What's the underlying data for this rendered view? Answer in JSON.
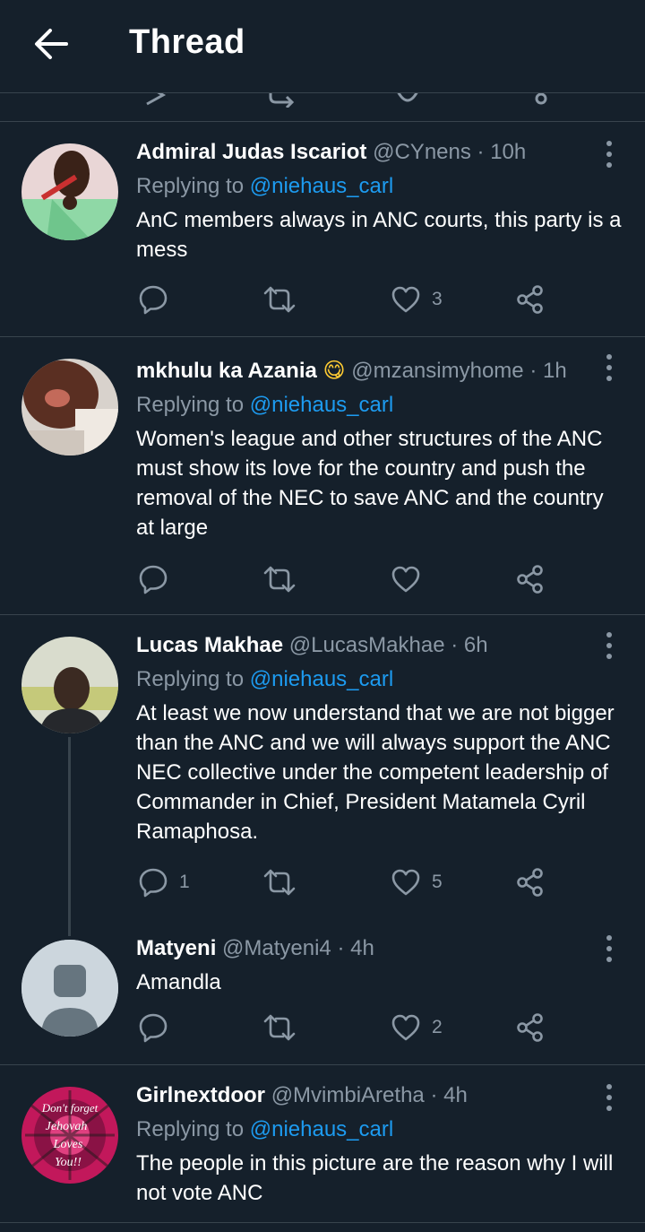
{
  "header": {
    "title": "Thread"
  },
  "tweets": [
    {
      "name": "Admiral Judas Iscariot",
      "handle": "@CYnens",
      "dot": "·",
      "time": "10h",
      "replying_prefix": "Replying to",
      "replying_to": "@niehaus_carl",
      "text": "AnC members always in ANC courts,  this party is a mess",
      "counts": {
        "reply": "",
        "retweet": "",
        "like": "3"
      }
    },
    {
      "name": "mkhulu ka Azania",
      "emoji": "😋",
      "handle": "@mzansimyhome",
      "dot": "·",
      "time": "1h",
      "replying_prefix": "Replying to",
      "replying_to": "@niehaus_carl",
      "text": "Women's league and other structures of the ANC must show its love for the country and push the removal of the NEC to save ANC and the country at large",
      "counts": {
        "reply": "",
        "retweet": "",
        "like": ""
      }
    },
    {
      "name": "Lucas Makhae",
      "handle": "@LucasMakhae",
      "dot": "·",
      "time": "6h",
      "replying_prefix": "Replying to",
      "replying_to": "@niehaus_carl",
      "text": "At least we now understand that we are not bigger than the ANC and we will always support the ANC NEC collective under the  competent leadership of Commander in Chief, President Matamela Cyril Ramaphosa.",
      "counts": {
        "reply": "1",
        "retweet": "",
        "like": "5"
      }
    },
    {
      "name": "Matyeni",
      "handle": "@Matyeni4",
      "dot": "·",
      "time": "4h",
      "text": "Amandla",
      "counts": {
        "reply": "",
        "retweet": "",
        "like": "2"
      }
    },
    {
      "name": "Girlnextdoor",
      "handle": "@MvimbiAretha",
      "dot": "·",
      "time": "4h",
      "replying_prefix": "Replying to",
      "replying_to": "@niehaus_carl",
      "text": "The people in this picture are the reason why I will not vote ANC",
      "avatar_text": [
        "Don't forget",
        "Jehovah",
        "Loves",
        "You!!"
      ]
    }
  ],
  "icons": {
    "back": "arrow-left-icon",
    "reply": "speech-bubble-icon",
    "retweet": "retweet-icon",
    "like": "heart-icon",
    "share": "share-icon",
    "more": "vertical-dots-icon"
  },
  "colors": {
    "background": "#15202b",
    "divider": "#38444d",
    "secondary_text": "#8b98a5",
    "link": "#1d9bf0"
  }
}
